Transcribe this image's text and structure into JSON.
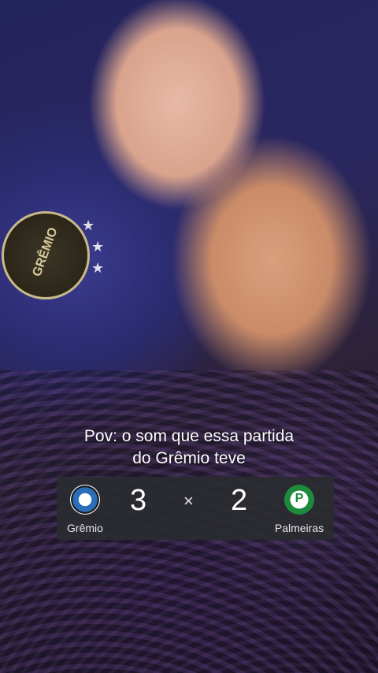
{
  "caption": {
    "line1": "Pov: o som que essa partida",
    "line2": "do Grêmio teve"
  },
  "scoreboard": {
    "home_team": "Grêmio",
    "home_score": "3",
    "separator": "×",
    "away_score": "2",
    "away_team": "Palmeiras"
  },
  "jersey_crest": {
    "text": "GRÊMIO"
  },
  "colors": {
    "scoreboard_bg": "#2a2c30",
    "gremio_blue": "#2a6fb8",
    "palmeiras_green": "#1e8a3c"
  }
}
